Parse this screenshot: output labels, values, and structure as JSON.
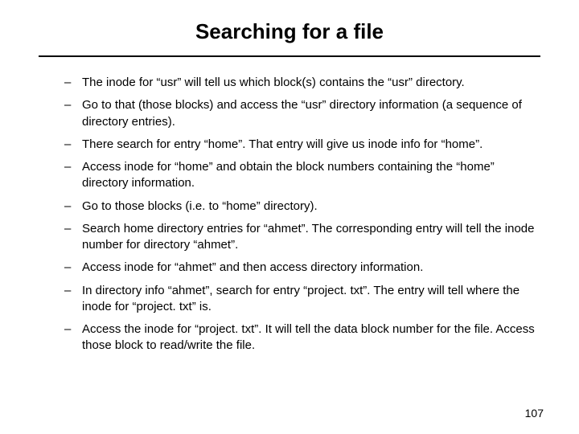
{
  "title": "Searching for a file",
  "bullets": [
    "The inode for “usr” will tell us which block(s) contains the “usr” directory.",
    "Go to that (those blocks) and access the “usr” directory information (a sequence of directory entries).",
    "There search for entry “home”. That entry will give us inode info for “home”.",
    "Access inode for “home” and obtain the block numbers containing the “home” directory information.",
    "Go to those blocks (i.e. to “home” directory).",
    "Search home directory entries for “ahmet”. The corresponding entry will tell the inode number for directory “ahmet”.",
    "Access inode for “ahmet” and then access directory information.",
    "In directory info “ahmet”, search for entry  “project. txt”. The entry will tell where the inode for “project. txt” is.",
    "Access the inode for “project. txt”. It will tell the data block number for the file. Access those block to read/write the file."
  ],
  "page_number": "107"
}
